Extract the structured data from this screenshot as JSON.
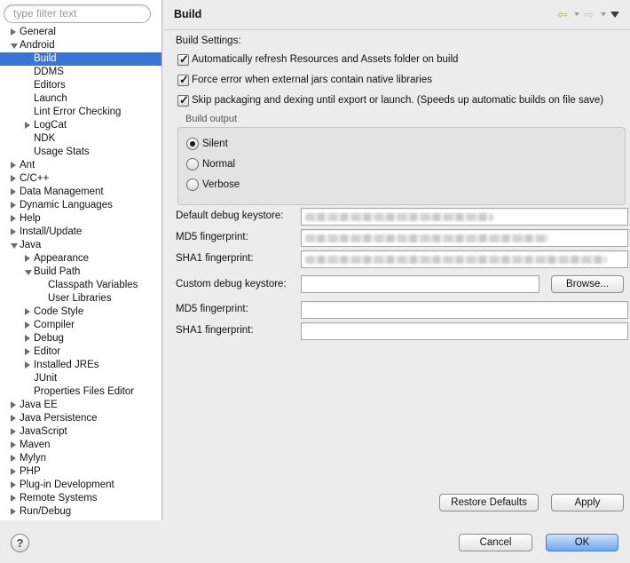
{
  "filter": {
    "placeholder": "type filter text"
  },
  "tree": [
    {
      "label": "General",
      "level": 0,
      "twisty": "closed"
    },
    {
      "label": "Android",
      "level": 0,
      "twisty": "open"
    },
    {
      "label": "Build",
      "level": 1,
      "twisty": "none",
      "selected": true
    },
    {
      "label": "DDMS",
      "level": 1,
      "twisty": "none"
    },
    {
      "label": "Editors",
      "level": 1,
      "twisty": "none"
    },
    {
      "label": "Launch",
      "level": 1,
      "twisty": "none"
    },
    {
      "label": "Lint Error Checking",
      "level": 1,
      "twisty": "none"
    },
    {
      "label": "LogCat",
      "level": 1,
      "twisty": "closed"
    },
    {
      "label": "NDK",
      "level": 1,
      "twisty": "none"
    },
    {
      "label": "Usage Stats",
      "level": 1,
      "twisty": "none"
    },
    {
      "label": "Ant",
      "level": 0,
      "twisty": "closed"
    },
    {
      "label": "C/C++",
      "level": 0,
      "twisty": "closed"
    },
    {
      "label": "Data Management",
      "level": 0,
      "twisty": "closed"
    },
    {
      "label": "Dynamic Languages",
      "level": 0,
      "twisty": "closed"
    },
    {
      "label": "Help",
      "level": 0,
      "twisty": "closed"
    },
    {
      "label": "Install/Update",
      "level": 0,
      "twisty": "closed"
    },
    {
      "label": "Java",
      "level": 0,
      "twisty": "open"
    },
    {
      "label": "Appearance",
      "level": 1,
      "twisty": "closed"
    },
    {
      "label": "Build Path",
      "level": 1,
      "twisty": "open"
    },
    {
      "label": "Classpath Variables",
      "level": 2,
      "twisty": "none"
    },
    {
      "label": "User Libraries",
      "level": 2,
      "twisty": "none"
    },
    {
      "label": "Code Style",
      "level": 1,
      "twisty": "closed"
    },
    {
      "label": "Compiler",
      "level": 1,
      "twisty": "closed"
    },
    {
      "label": "Debug",
      "level": 1,
      "twisty": "closed"
    },
    {
      "label": "Editor",
      "level": 1,
      "twisty": "closed"
    },
    {
      "label": "Installed JREs",
      "level": 1,
      "twisty": "closed"
    },
    {
      "label": "JUnit",
      "level": 1,
      "twisty": "none"
    },
    {
      "label": "Properties Files Editor",
      "level": 1,
      "twisty": "none"
    },
    {
      "label": "Java EE",
      "level": 0,
      "twisty": "closed"
    },
    {
      "label": "Java Persistence",
      "level": 0,
      "twisty": "closed"
    },
    {
      "label": "JavaScript",
      "level": 0,
      "twisty": "closed"
    },
    {
      "label": "Maven",
      "level": 0,
      "twisty": "closed"
    },
    {
      "label": "Mylyn",
      "level": 0,
      "twisty": "closed"
    },
    {
      "label": "PHP",
      "level": 0,
      "twisty": "closed"
    },
    {
      "label": "Plug-in Development",
      "level": 0,
      "twisty": "closed"
    },
    {
      "label": "Remote Systems",
      "level": 0,
      "twisty": "closed"
    },
    {
      "label": "Run/Debug",
      "level": 0,
      "twisty": "closed"
    }
  ],
  "page": {
    "title": "Build",
    "nav_icons": [
      "back-arrow-icon",
      "forward-arrow-icon",
      "view-menu-icon"
    ],
    "settings_label": "Build Settings:",
    "checkboxes": [
      {
        "label": "Automatically refresh Resources and Assets folder on build",
        "checked": true
      },
      {
        "label": "Force error when external jars contain native libraries",
        "checked": true
      },
      {
        "label": "Skip packaging and dexing until export or launch. (Speeds up automatic builds on file save)",
        "checked": true
      }
    ],
    "build_output": {
      "title": "Build output",
      "options": [
        "Silent",
        "Normal",
        "Verbose"
      ],
      "selected": "Silent"
    },
    "fields": {
      "default_keystore_label": "Default debug keystore:",
      "md5_label": "MD5 fingerprint:",
      "sha1_label": "SHA1 fingerprint:",
      "custom_keystore_label": "Custom debug keystore:",
      "custom_md5_label": "MD5 fingerprint:",
      "custom_sha1_label": "SHA1 fingerprint:",
      "custom_keystore_value": "",
      "custom_md5_value": "",
      "custom_sha1_value": ""
    },
    "browse_label": "Browse...",
    "restore_label": "Restore Defaults",
    "apply_label": "Apply"
  },
  "footer": {
    "help_label": "?",
    "cancel_label": "Cancel",
    "ok_label": "OK"
  },
  "colors": {
    "selection": "#3875d7",
    "ok_button": "#6ea6ee",
    "back_arrow": "#e8a93a"
  }
}
